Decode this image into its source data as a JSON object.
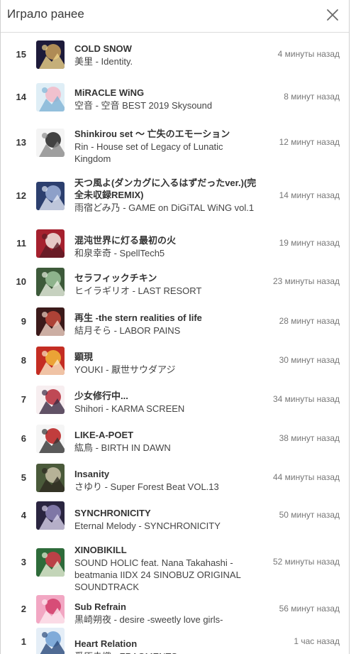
{
  "header": {
    "title": "Играло ранее",
    "close_icon": "close-icon"
  },
  "tracks": [
    {
      "num": "15",
      "title": "COLD SNOW",
      "subtitle": "美里 - Identity.",
      "time": "4 минуты назад",
      "colors": [
        "#1d1a3a",
        "#c9a05a",
        "#f0d48a"
      ]
    },
    {
      "num": "14",
      "title": "MiRACLE WiNG",
      "subtitle": "空音 - 空音 BEST 2019 Skysound",
      "time": "8 минут назад",
      "colors": [
        "#dfeef6",
        "#f3b9c7",
        "#7fb3d6"
      ]
    },
    {
      "num": "13",
      "title": "Shinkirou set ～ 亡失のエモーション",
      "subtitle": "Rin - House set of Legacy of Lunatic Kingdom",
      "time": "12 минут назад",
      "colors": [
        "#f4f4f4",
        "#222222",
        "#8a8a8a"
      ]
    },
    {
      "num": "12",
      "title": "天つ風よ(ダンカグに入るはずだったver.)(完全未収録REMIX)",
      "subtitle": "雨宿どみ乃 - GAME on DiGiTAL WiNG vol.1",
      "time": "14 минут назад",
      "colors": [
        "#2c3f6e",
        "#9fb2d9",
        "#e3e9f5"
      ]
    },
    {
      "num": "11",
      "title": "混沌世界に灯る最初の火",
      "subtitle": "和泉幸奇 - SpellTech5",
      "time": "19 минут назад",
      "colors": [
        "#a5202e",
        "#f1e6e0",
        "#5a1a24"
      ]
    },
    {
      "num": "10",
      "title": "セラフィックチキン",
      "subtitle": "ヒイラギリオ - LAST RESORT",
      "time": "23 минуты назад",
      "colors": [
        "#3d5a3a",
        "#9cc39b",
        "#e8efe1"
      ]
    },
    {
      "num": "9",
      "title": "再生 -the stern realities of life",
      "subtitle": "結月そら - LABOR PAINS",
      "time": "28 минут назад",
      "colors": [
        "#3b1a1a",
        "#c24a3c",
        "#f1d3c5"
      ]
    },
    {
      "num": "8",
      "title": "顕現",
      "subtitle": "YOUKI - 厭世サウダアジ",
      "time": "30 минут назад",
      "colors": [
        "#c42d23",
        "#f2b83a",
        "#fbe8c6"
      ]
    },
    {
      "num": "7",
      "title": "少女修行中...",
      "subtitle": "Shihori - KARMA SCREEN",
      "time": "34 минуты назад",
      "colors": [
        "#f7eef0",
        "#b52b3a",
        "#3b2b44"
      ]
    },
    {
      "num": "6",
      "title": "LIKE-A-POET",
      "subtitle": "紘鳥 - BIRTH IN DAWN",
      "time": "38 минут назад",
      "colors": [
        "#f5f5f5",
        "#b71c1c",
        "#333333"
      ]
    },
    {
      "num": "5",
      "title": "Insanity",
      "subtitle": "さゆり - Super Forest Beat VOL.13",
      "time": "44 минуты назад",
      "colors": [
        "#4a5a3a",
        "#c9c2a8",
        "#2e2a22"
      ]
    },
    {
      "num": "4",
      "title": "SYNCHRONICITY",
      "subtitle": "Eternal Melody - SYNCHRONICITY",
      "time": "50 минут назад",
      "colors": [
        "#2a2540",
        "#8e86b8",
        "#d8d2ea"
      ]
    },
    {
      "num": "3",
      "title": "XINOBIKILL",
      "subtitle": "SOUND HOLIC feat. Nana Takahashi - beatmania IIDX 24 SINOBUZ ORIGINAL SOUNDTRACK",
      "time": "52 минуты назад",
      "colors": [
        "#2e6b3a",
        "#d43a4a",
        "#e9f0d8"
      ]
    },
    {
      "num": "2",
      "title": "Sub Refrain",
      "subtitle": "黒崎朔夜 - desire -sweetly love girls-",
      "time": "56 минут назад",
      "colors": [
        "#f2a7c3",
        "#d23d6a",
        "#fde8ef"
      ]
    },
    {
      "num": "1",
      "title": "Heart Relation",
      "subtitle": "愛原圭織 - FRAGMENTS",
      "time": "1 час назад",
      "colors": [
        "#e5eef7",
        "#6f9fd3",
        "#2b4a7a"
      ]
    }
  ]
}
